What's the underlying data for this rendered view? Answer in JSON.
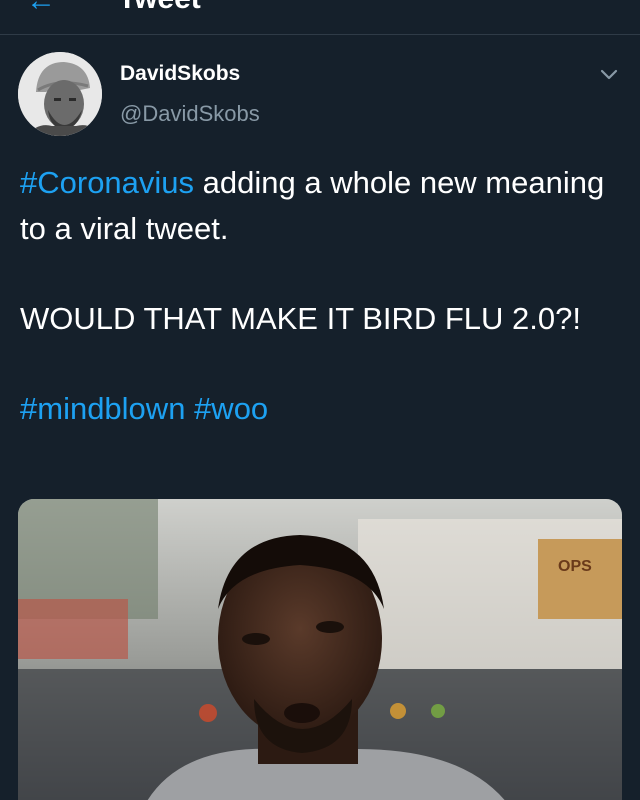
{
  "header": {
    "title": "Tweet"
  },
  "author": {
    "display_name": "DavidSkobs",
    "handle": "@DavidSkobs"
  },
  "tweet": {
    "line1_hashtag": "#Coronavius",
    "line1_rest": " adding a whole new meaning to a viral tweet.",
    "line2": "WOULD THAT MAKE IT BIRD FLU 2.0?!",
    "hashtags": [
      "#mindblown",
      "#woo"
    ]
  },
  "media_sign_text": "OPS",
  "colors": {
    "background": "#15202b",
    "accent": "#1da1f2",
    "secondary_text": "#8899a6"
  },
  "icons": {
    "back": "back-arrow-icon",
    "more": "chevron-down-icon"
  }
}
